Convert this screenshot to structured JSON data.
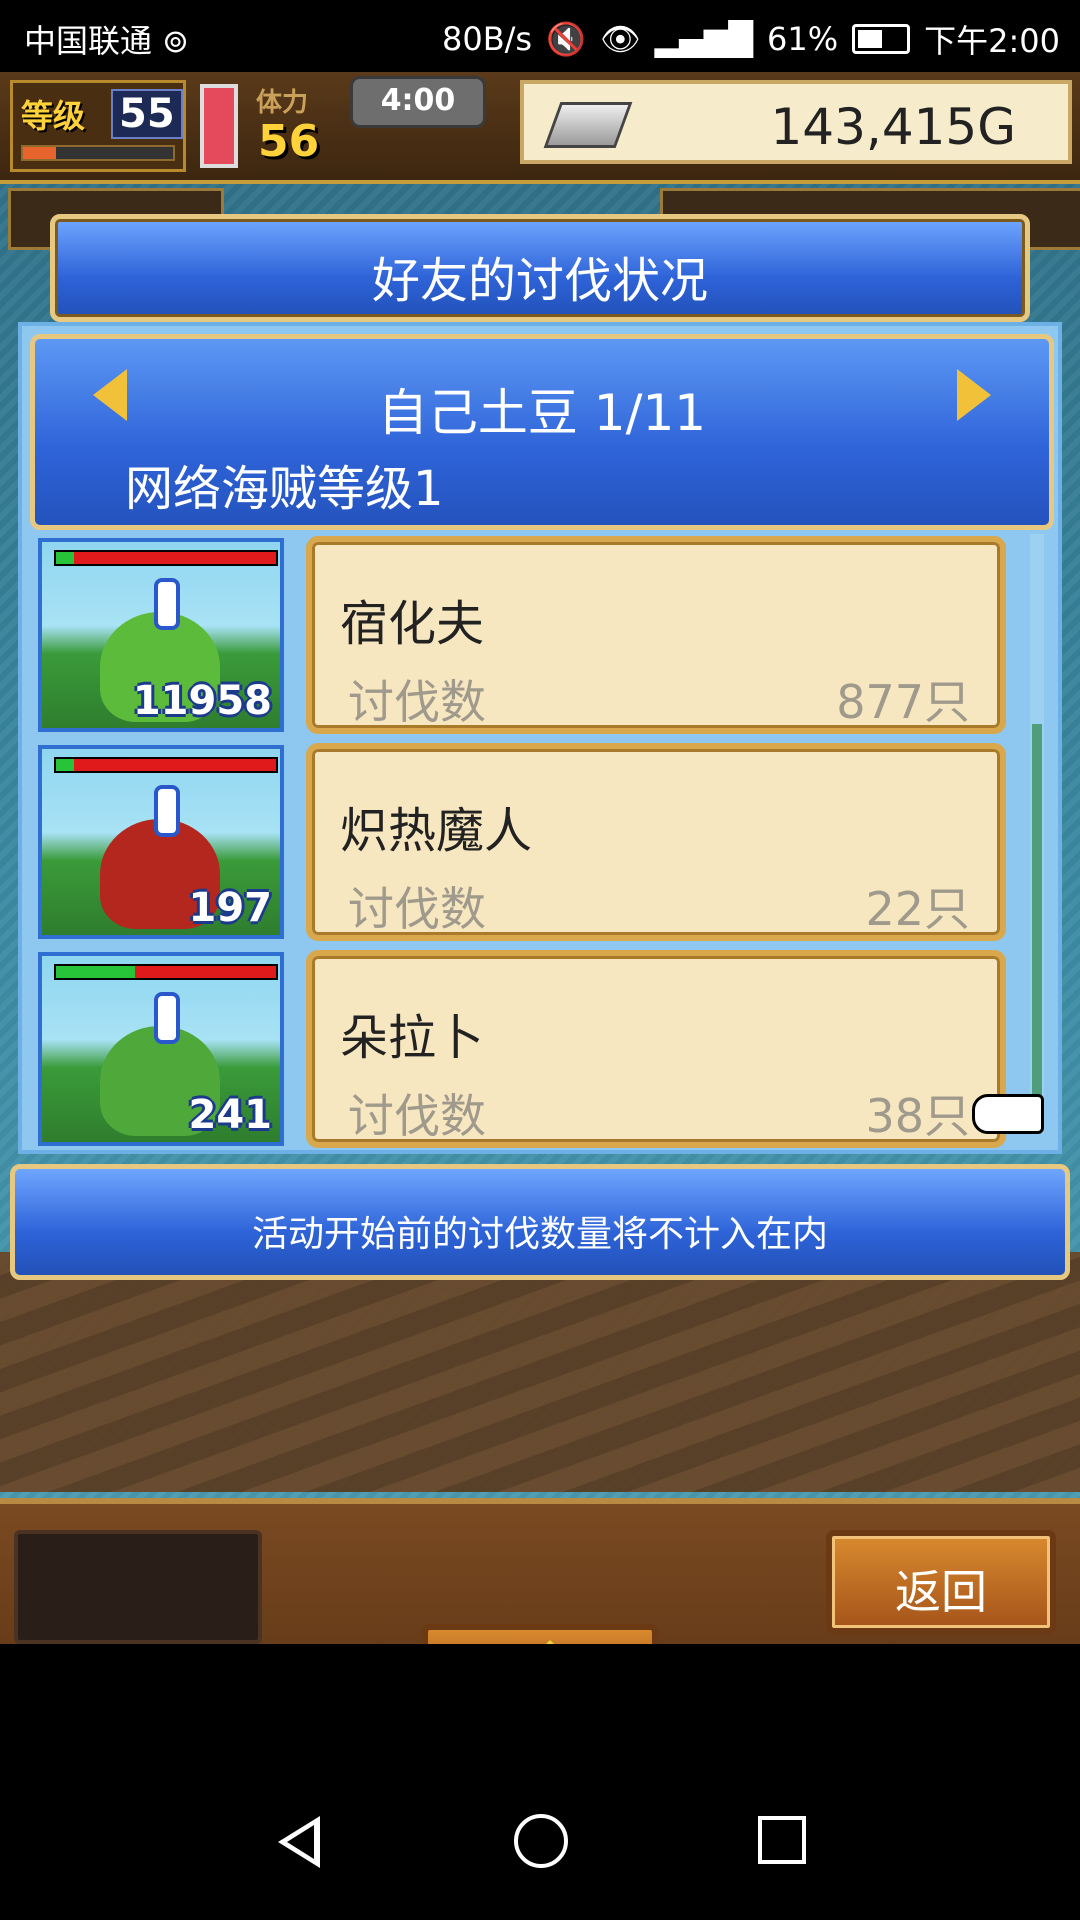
{
  "status_bar": {
    "carrier": "中国联通 ⊚",
    "speed": "80B/s",
    "battery": "61%",
    "battery_level": 0.61,
    "time": "下午2:00"
  },
  "hud": {
    "level_label": "等级",
    "level_value": "55",
    "stamina_label": "体力",
    "stamina_value": "56",
    "timer": "4:00",
    "money": "143,415G"
  },
  "dialog": {
    "title": "好友的讨伐状况",
    "friend_name": "自己土豆 1/11",
    "pirate_level": "网络海贼等级1",
    "note": "活动开始前的讨伐数量将不计入在内"
  },
  "monsters": [
    {
      "name": "宿化夫",
      "kill_label": "讨伐数",
      "kills": "877只",
      "count": "11958",
      "hp_green": 0.08,
      "color": "#5dbb3c"
    },
    {
      "name": "炽热魔人",
      "kill_label": "讨伐数",
      "kills": "22只",
      "count": "197",
      "hp_green": 0.08,
      "color": "#b3271f"
    },
    {
      "name": "朵拉卜",
      "kill_label": "讨伐数",
      "kills": "38只",
      "count": "241",
      "hp_green": 0.36,
      "color": "#4fa83a"
    }
  ],
  "buttons": {
    "back": "返回"
  }
}
